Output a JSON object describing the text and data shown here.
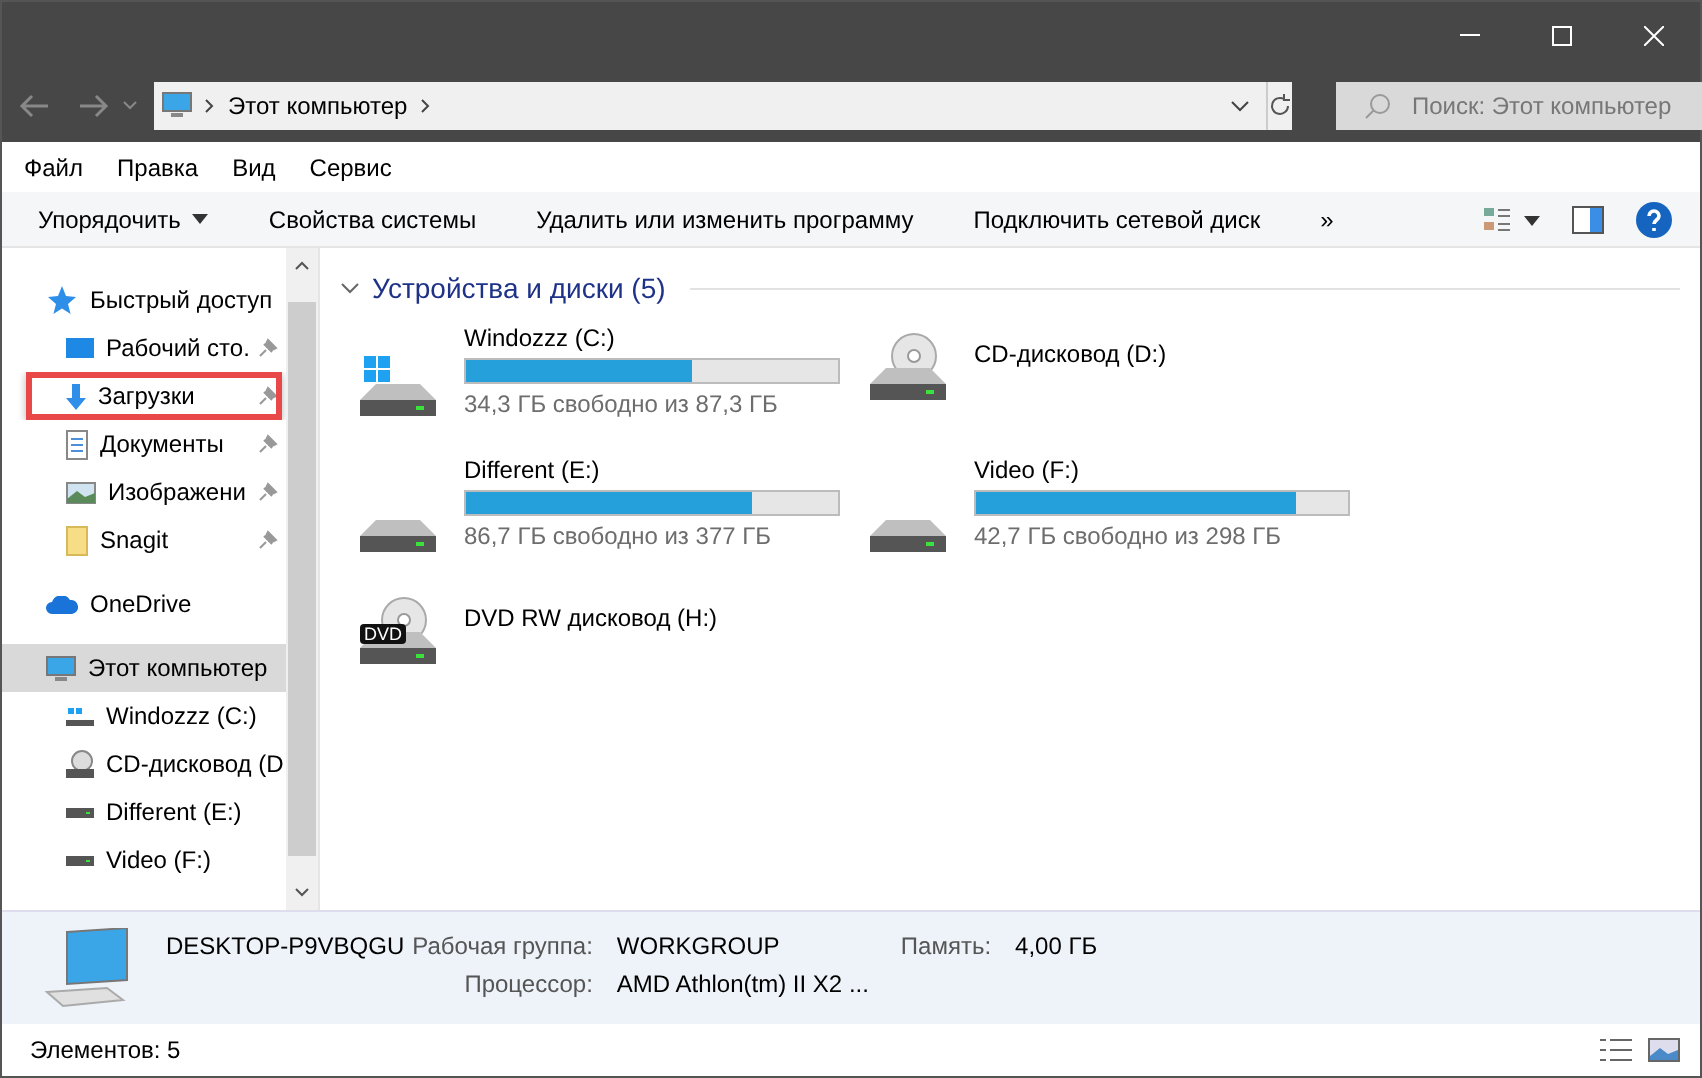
{
  "address": {
    "path": "Этот компьютер"
  },
  "search": {
    "placeholder": "Поиск: Этот компьютер"
  },
  "menu": [
    "Файл",
    "Правка",
    "Вид",
    "Сервис"
  ],
  "toolbar": [
    {
      "label": "Упорядочить",
      "dropdown": true
    },
    {
      "label": "Свойства системы",
      "dropdown": false
    },
    {
      "label": "Удалить или изменить программу",
      "dropdown": false
    },
    {
      "label": "Подключить сетевой диск",
      "dropdown": false
    }
  ],
  "more": "»",
  "sidebar": [
    {
      "label": "Быстрый доступ",
      "kind": "star",
      "pinned": false,
      "selected": false,
      "highlighted": false,
      "children": [
        {
          "label": "Рабочий сто.",
          "kind": "desktop",
          "pinned": true,
          "selected": false,
          "highlighted": false
        },
        {
          "label": "Загрузки",
          "kind": "download",
          "pinned": true,
          "selected": false,
          "highlighted": true
        },
        {
          "label": "Документы",
          "kind": "document",
          "pinned": true,
          "selected": false,
          "highlighted": false
        },
        {
          "label": "Изображени",
          "kind": "image",
          "pinned": true,
          "selected": false,
          "highlighted": false
        },
        {
          "label": "Snagit",
          "kind": "folder",
          "pinned": true,
          "selected": false,
          "highlighted": false
        }
      ]
    },
    {
      "label": "OneDrive",
      "kind": "cloud",
      "pinned": false,
      "selected": false,
      "highlighted": false
    },
    {
      "label": "Этот компьютер",
      "kind": "computer",
      "pinned": false,
      "selected": true,
      "highlighted": false,
      "children": [
        {
          "label": "Windozzz (C:)",
          "kind": "system",
          "pinned": false,
          "selected": false,
          "highlighted": false
        },
        {
          "label": "CD-дисковод (D",
          "kind": "cd",
          "pinned": false,
          "selected": false,
          "highlighted": false
        },
        {
          "label": "Different (E:)",
          "kind": "drive",
          "pinned": false,
          "selected": false,
          "highlighted": false
        },
        {
          "label": "Video (F:)",
          "kind": "drive",
          "pinned": false,
          "selected": false,
          "highlighted": false
        }
      ]
    }
  ],
  "group": {
    "title": "Устройства и диски (5)",
    "expanded": true
  },
  "drives": [
    {
      "kind": "system",
      "name": "Windozzz (C:)",
      "level": 0.61,
      "free": "34,3 ГБ свободно из 87,3 ГБ"
    },
    {
      "kind": "cd",
      "name": "CD-дисковод (D:)"
    },
    {
      "kind": "hdd",
      "name": "Different (E:)",
      "level": 0.77,
      "free": "86,7 ГБ свободно из 377 ГБ"
    },
    {
      "kind": "hdd",
      "name": "Video (F:)",
      "level": 0.86,
      "free": "42,7 ГБ свободно из 298 ГБ"
    },
    {
      "kind": "dvd",
      "name": "DVD RW дисковод (H:)",
      "badge": "DVD"
    }
  ],
  "details": {
    "computer": "DESKTOP-P9VBQGU",
    "fields": [
      {
        "label": "Рабочая группа:",
        "value": "WORKGROUP"
      },
      {
        "label": "Память:",
        "value": "4,00 ГБ"
      },
      {
        "label": "Процессор:",
        "value": "AMD Athlon(tm) II X2 ..."
      }
    ]
  },
  "status_bar": "Элементов: 5"
}
